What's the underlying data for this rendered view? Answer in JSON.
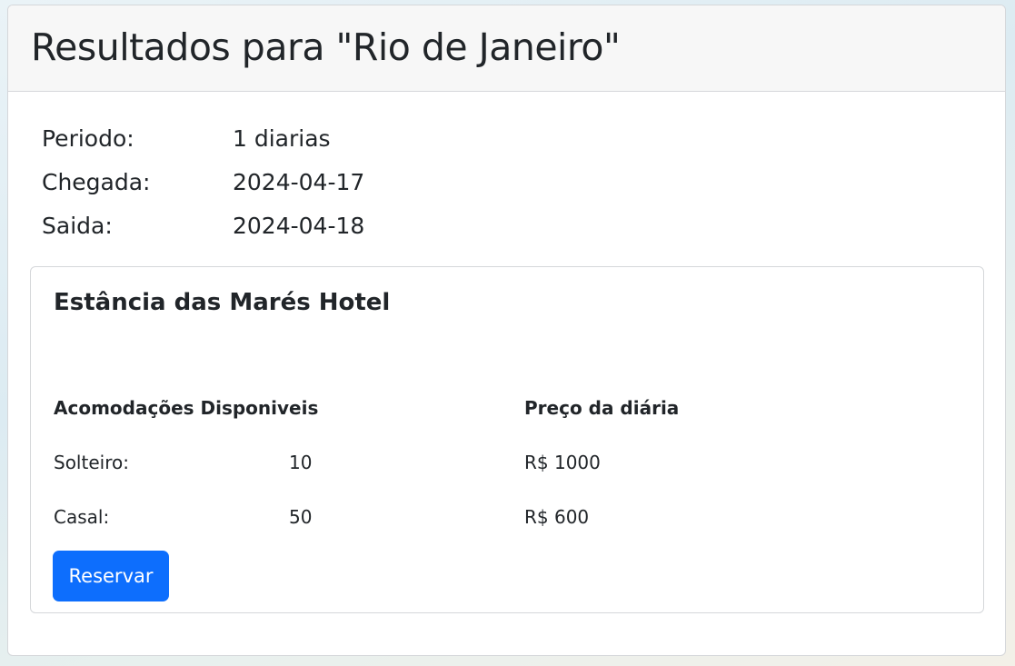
{
  "page": {
    "title": "Resultados para \"Rio de Janeiro\""
  },
  "summary": {
    "period_label": "Periodo:",
    "period_value": "1 diarias",
    "arrival_label": "Chegada:",
    "arrival_value": "2024-04-17",
    "departure_label": "Saida:",
    "departure_value": "2024-04-18"
  },
  "hotel": {
    "name": "Estância das Marés Hotel",
    "rooms_header": "Acomodações Disponiveis",
    "price_header": "Preço da diária",
    "rooms": [
      {
        "type": "Solteiro:",
        "count": "10",
        "price": "R$ 1000"
      },
      {
        "type": "Casal:",
        "count": "50",
        "price": "R$ 600"
      }
    ],
    "reserve_label": "Reservar"
  },
  "colors": {
    "primary": "#0d6efd",
    "header_bg": "#f7f7f7",
    "border": "#d5d7da",
    "text": "#212529"
  }
}
